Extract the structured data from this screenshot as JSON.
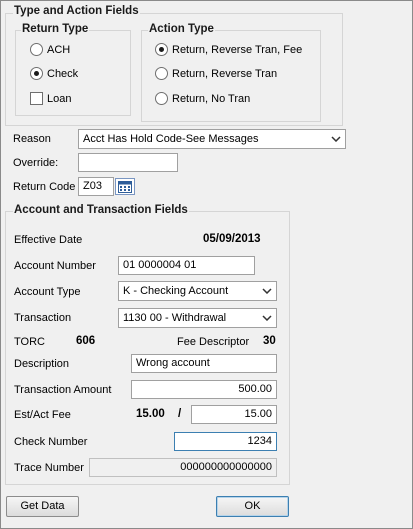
{
  "type_action": {
    "title": "Type and Action Fields",
    "return_type": {
      "title": "Return Type",
      "options": [
        {
          "label": "ACH",
          "selected": false
        },
        {
          "label": "Check",
          "selected": true
        }
      ],
      "loan_label": "Loan",
      "loan_checked": false
    },
    "action_type": {
      "title": "Action Type",
      "options": [
        {
          "label": "Return, Reverse Tran, Fee",
          "selected": true
        },
        {
          "label": "Return, Reverse Tran",
          "selected": false
        },
        {
          "label": "Return, No Tran",
          "selected": false
        }
      ]
    }
  },
  "reason": {
    "label": "Reason",
    "value": "Acct Has Hold Code-See Messages",
    "icon": "chevron-down-icon"
  },
  "override": {
    "label": "Override:",
    "value": ""
  },
  "return_code": {
    "label": "Return Code",
    "value": "Z03",
    "icon": "calendar-list-icon"
  },
  "account": {
    "title": "Account and Transaction Fields",
    "effective_date_label": "Effective Date",
    "effective_date": "05/09/2013",
    "account_number_label": "Account Number",
    "account_number": "01 0000004 01",
    "account_type_label": "Account Type",
    "account_type": "K - Checking Account",
    "transaction_label": "Transaction",
    "transaction": "1130 00 - Withdrawal",
    "torc_label": "TORC",
    "torc_value": "606",
    "fee_descriptor_label": "Fee Descriptor",
    "fee_descriptor_value": "30",
    "description_label": "Description",
    "description": "Wrong account",
    "transaction_amount_label": "Transaction Amount",
    "transaction_amount": "500.00",
    "est_act_fee_label": "Est/Act Fee",
    "est_fee": "15.00",
    "fee_separator": "/",
    "act_fee": "15.00",
    "check_number_label": "Check Number",
    "check_number": "1234",
    "trace_number_label": "Trace Number",
    "trace_number": "000000000000000"
  },
  "buttons": {
    "get_data": "Get Data",
    "ok": "OK"
  }
}
